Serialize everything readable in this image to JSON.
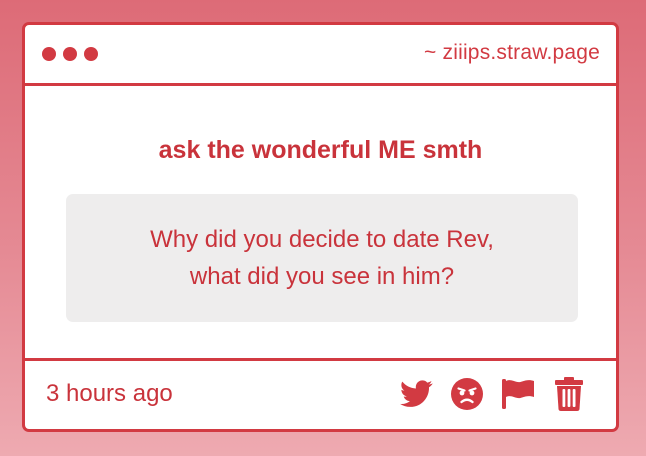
{
  "window": {
    "url": "~ ziiips.straw.page"
  },
  "main": {
    "prompt": "ask the wonderful ME smth",
    "question_line1": "Why did you decide to date Rev,",
    "question_line2": "what did you see in him?"
  },
  "footer": {
    "timestamp": "3 hours ago",
    "icons": [
      "twitter-icon",
      "angry-face-icon",
      "flag-icon",
      "trash-icon"
    ]
  },
  "colors": {
    "accent": "#d23a42",
    "background_top": "#dd6b77",
    "background_bottom": "#eeaab1",
    "question_bg": "#eeeded"
  }
}
